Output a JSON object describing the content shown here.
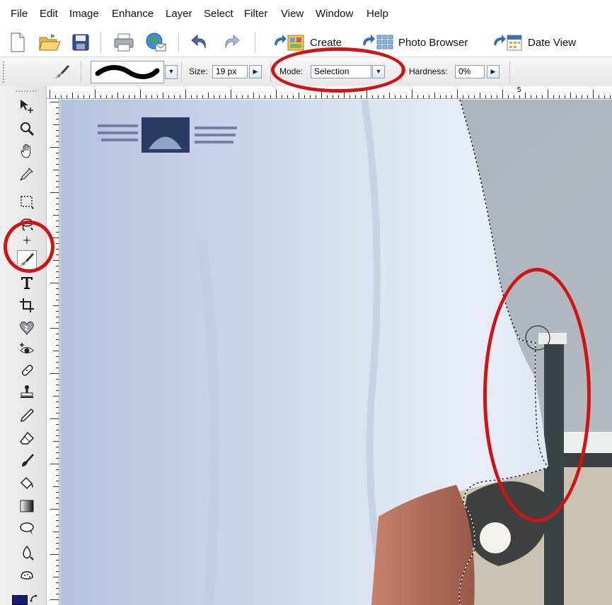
{
  "menu": [
    "File",
    "Edit",
    "Image",
    "Enhance",
    "Layer",
    "Select",
    "Filter",
    "View",
    "Window",
    "Help"
  ],
  "toolbar": {
    "create_label": "Create",
    "photo_browser_label": "Photo Browser",
    "date_view_label": "Date View"
  },
  "options": {
    "size_label": "Size:",
    "size_value": "19 px",
    "mode_label": "Mode:",
    "mode_value": "Selection",
    "hardness_label": "Hardness:",
    "hardness_value": "0%"
  },
  "ruler": {
    "h_label": "5"
  },
  "colors": {
    "annotation": "#d01414",
    "foreground_swatch": "#1a1a7a",
    "shirt": "#c7d3e8",
    "wall": "#a9b0b8"
  },
  "icons": {
    "tools": [
      "move-icon",
      "zoom-icon",
      "hand-icon",
      "eyedropper-icon",
      "marquee-icon",
      "lasso-icon",
      "magic-wand-icon",
      "selection-brush-icon",
      "type-icon",
      "crop-icon",
      "cookie-cutter-icon",
      "red-eye-icon",
      "healing-brush-icon",
      "clone-stamp-icon",
      "pencil-icon",
      "eraser-icon",
      "brush-icon",
      "paint-bucket-icon",
      "gradient-icon",
      "shape-icon",
      "blur-icon",
      "sponge-icon"
    ]
  }
}
